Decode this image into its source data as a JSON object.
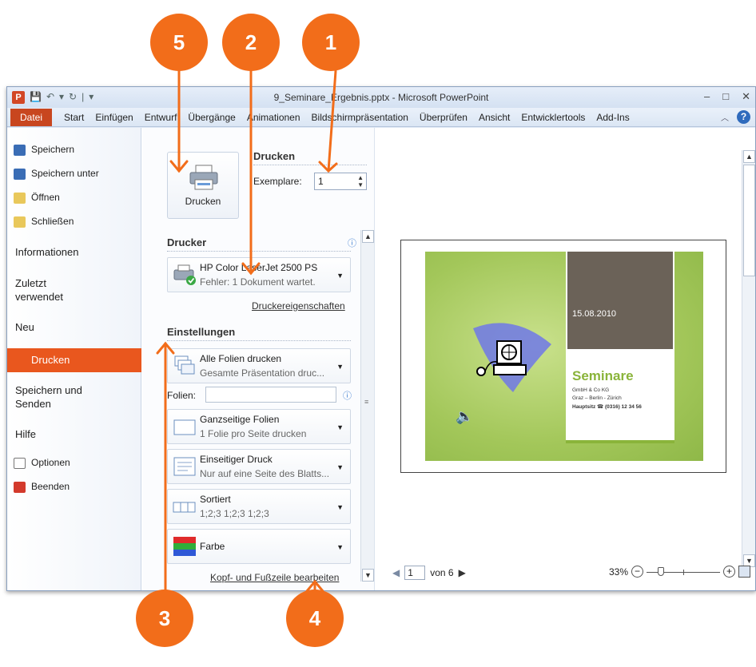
{
  "callouts": [
    "5",
    "2",
    "1",
    "3",
    "4"
  ],
  "window": {
    "title": "9_Seminare_Ergebnis.pptx - Microsoft PowerPoint",
    "app_icon_letter": "P",
    "qat": [
      "💾",
      "↶",
      "▾",
      "↻",
      "|",
      "▾"
    ],
    "controls": [
      "–",
      "□",
      "✕"
    ]
  },
  "ribbon": {
    "file_tab": "Datei",
    "tabs": [
      "Start",
      "Einfügen",
      "Entwurf",
      "Übergänge",
      "Animationen",
      "Bildschirmpräsentation",
      "Überprüfen",
      "Ansicht",
      "Entwicklertools",
      "Add-Ins"
    ],
    "help": "?"
  },
  "nav": {
    "items": [
      {
        "label": "Speichern",
        "icon": "save-icon"
      },
      {
        "label": "Speichern unter",
        "icon": "save-as-icon"
      },
      {
        "label": "Öffnen",
        "icon": "open-folder-icon"
      },
      {
        "label": "Schließen",
        "icon": "close-folder-icon"
      }
    ],
    "info": "Informationen",
    "recent_1": "Zuletzt",
    "recent_2": "verwendet",
    "new": "Neu",
    "print": "Drucken",
    "save_send_1": "Speichern und",
    "save_send_2": "Senden",
    "help": "Hilfe",
    "options": "Optionen",
    "exit": "Beenden"
  },
  "print": {
    "button_label": "Drucken",
    "section_title": "Drucken",
    "copies_label": "Exemplare:",
    "copies_value": "1",
    "printer_section": "Drucker",
    "printer_name": "HP Color LaserJet 2500 PS",
    "printer_status": "Fehler: 1 Dokument wartet.",
    "printer_properties": "Druckereigenschaften",
    "settings_section": "Einstellungen",
    "slides_label": "Folien:",
    "slides_value": "",
    "header_footer_link": "Kopf- und Fußzeile bearbeiten",
    "dropdowns": [
      {
        "title": "Alle Folien drucken",
        "sub": "Gesamte Präsentation druc..."
      },
      {
        "title": "Ganzseitige Folien",
        "sub": "1 Folie pro Seite drucken"
      },
      {
        "title": "Einseitiger Druck",
        "sub": "Nur auf eine Seite des Blatts..."
      },
      {
        "title": "Sortiert",
        "sub": "1;2;3   1;2;3   1;2;3"
      },
      {
        "title": "Farbe",
        "sub": ""
      }
    ]
  },
  "preview": {
    "slide": {
      "date": "15.08.2010",
      "title": "Seminare",
      "line1": "GmbH & Co KG",
      "line2": "Graz – Berlin - Zürich",
      "line3": "Hauptsitz ☎ (0316) 12 34 56"
    },
    "page_value": "1",
    "page_of": "von 6",
    "zoom": "33%"
  }
}
